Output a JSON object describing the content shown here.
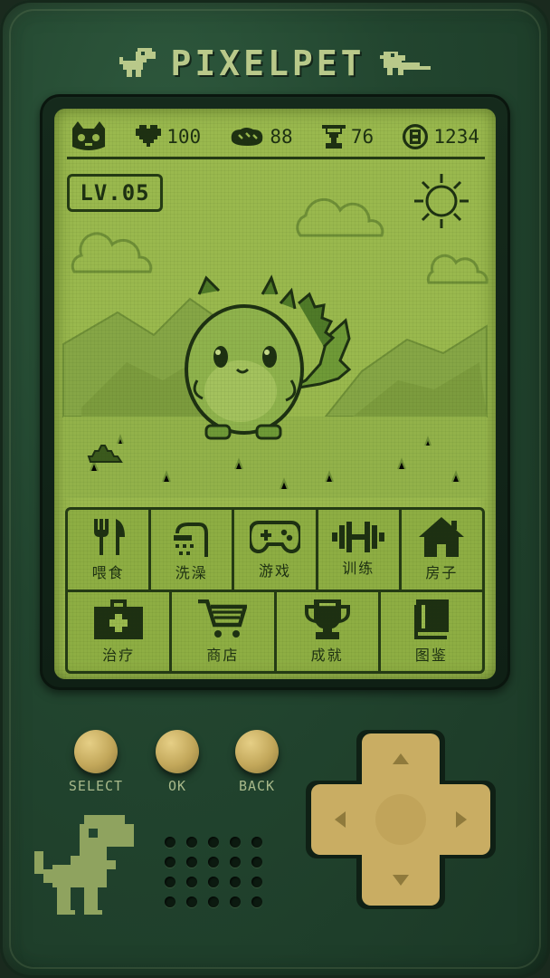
{
  "brand": {
    "title": "PIXELPET"
  },
  "stats": {
    "mood_icon": "pet-face-icon",
    "health": "100",
    "food": "88",
    "trophy": "76",
    "coins": "1234"
  },
  "level": "LV.05",
  "weather_icon": "sun-icon",
  "menu": {
    "row1": [
      {
        "label": "喂食",
        "icon": "fork-knife-icon"
      },
      {
        "label": "洗澡",
        "icon": "shower-icon"
      },
      {
        "label": "游戏",
        "icon": "gamepad-icon"
      },
      {
        "label": "训练",
        "icon": "dumbbell-icon"
      },
      {
        "label": "房子",
        "icon": "house-icon"
      }
    ],
    "row2": [
      {
        "label": "治疗",
        "icon": "medkit-icon"
      },
      {
        "label": "商店",
        "icon": "cart-icon"
      },
      {
        "label": "成就",
        "icon": "trophy-icon"
      },
      {
        "label": "图鉴",
        "icon": "book-icon"
      }
    ]
  },
  "buttons": {
    "select": "SELECT",
    "ok": "OK",
    "back": "BACK"
  },
  "colors": {
    "lcd": "#9ab94e",
    "lcd_ink": "#1d3012",
    "shell": "#22452f",
    "button": "#c9ad63",
    "label": "#a8b98a"
  }
}
